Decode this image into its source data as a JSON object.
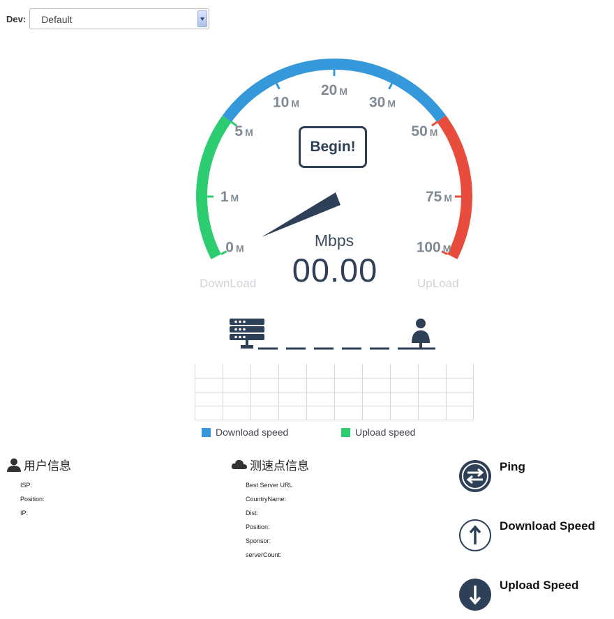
{
  "dev": {
    "label": "Dev:",
    "selected": "Default"
  },
  "gauge": {
    "ticks": [
      {
        "num": "0",
        "unit": "M"
      },
      {
        "num": "1",
        "unit": "M"
      },
      {
        "num": "5",
        "unit": "M"
      },
      {
        "num": "10",
        "unit": "M"
      },
      {
        "num": "20",
        "unit": "M"
      },
      {
        "num": "30",
        "unit": "M"
      },
      {
        "num": "50",
        "unit": "M"
      },
      {
        "num": "75",
        "unit": "M"
      },
      {
        "num": "100",
        "unit": "M"
      }
    ],
    "begin_label": "Begin!",
    "unit": "Mbps",
    "value": "00.00",
    "download_label": "DownLoad",
    "upload_label": "UpLoad",
    "colors": {
      "green": "#2ecc71",
      "blue": "#3498db",
      "red": "#e74c3c",
      "navy": "#2e4057"
    }
  },
  "legend": {
    "download": "Download speed",
    "upload": "Upload speed"
  },
  "user_info": {
    "title": "用户信息",
    "fields": [
      "ISP:",
      "Position:",
      "IP:"
    ]
  },
  "server_info": {
    "title": "测速点信息",
    "fields": [
      "Best Server URL",
      "CountryName:",
      "Dist:",
      "Position:",
      "Sponsor:",
      "serverCount:"
    ]
  },
  "stats": {
    "ping": "Ping",
    "download": "Download Speed",
    "upload": "Upload Speed"
  },
  "icons": [
    "user-icon",
    "cloud-icon",
    "server-icon",
    "client-user-icon",
    "ping-swap-icon",
    "arrow-up-icon",
    "arrow-down-icon"
  ]
}
